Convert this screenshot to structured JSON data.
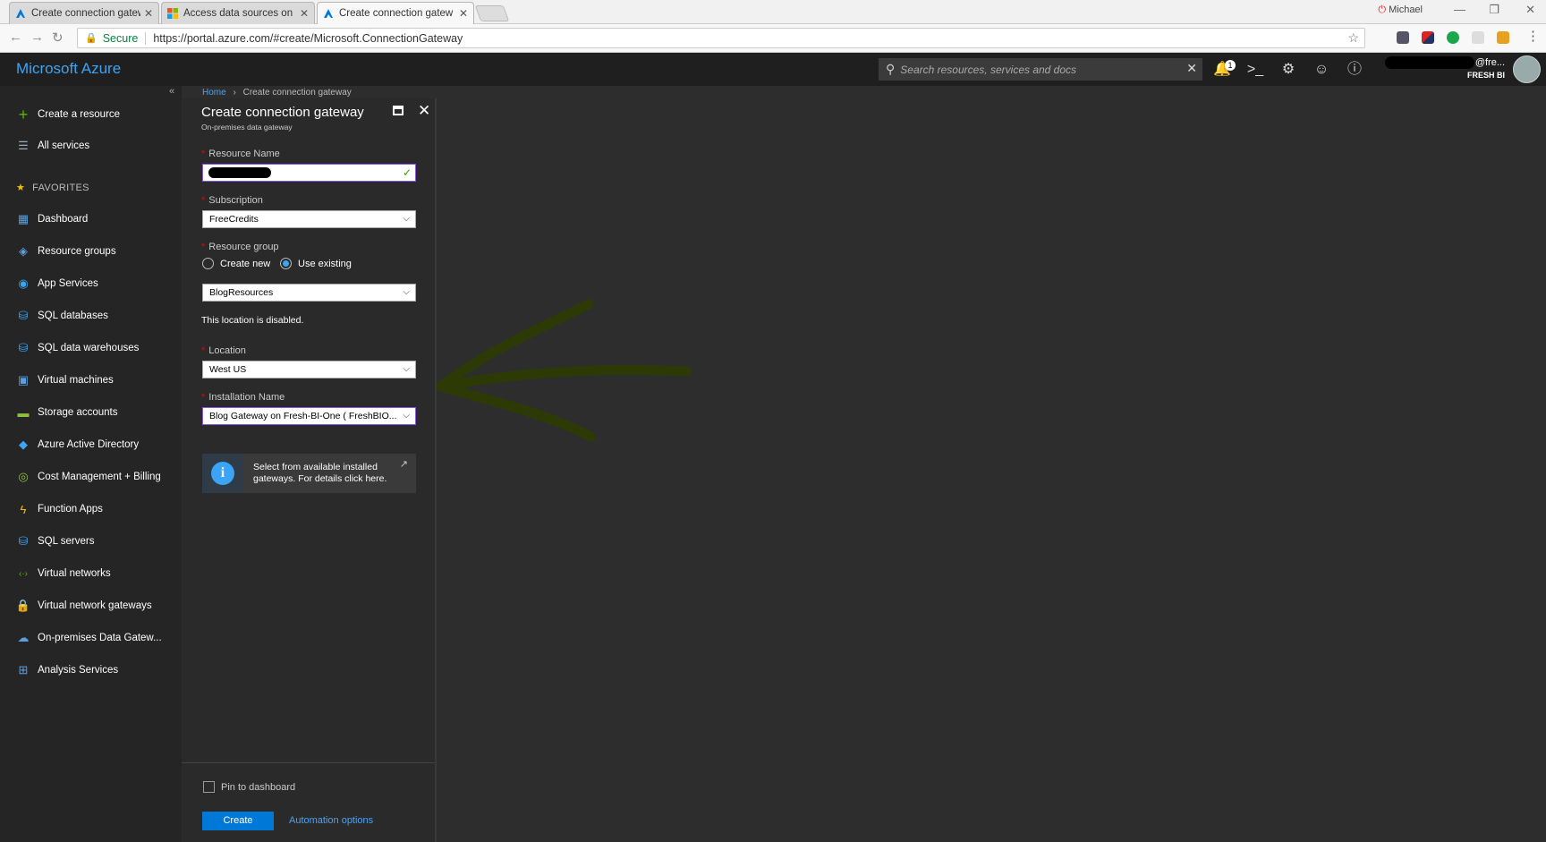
{
  "browser": {
    "tabs": [
      {
        "title": "Create connection gatew",
        "active": false
      },
      {
        "title": "Access data sources on p",
        "active": false
      },
      {
        "title": "Create connection gatew",
        "active": true
      }
    ],
    "profile_name": "Michael",
    "secure_label": "Secure",
    "url": "https://portal.azure.com/#create/Microsoft.ConnectionGateway"
  },
  "header": {
    "brand": "Microsoft Azure",
    "search_placeholder": "Search resources, services and docs",
    "notification_count": "1",
    "user_email_fragment": "@fre...",
    "user_directory": "FRESH BI"
  },
  "sidebar": {
    "top_items": [
      {
        "label": "Create a resource",
        "icon": "plus-icon"
      },
      {
        "label": "All services",
        "icon": "list-icon"
      }
    ],
    "favorites_label": "FAVORITES",
    "items": [
      {
        "label": "Dashboard",
        "icon": "dashboard-icon"
      },
      {
        "label": "Resource groups",
        "icon": "resource-groups-icon"
      },
      {
        "label": "App Services",
        "icon": "app-services-icon"
      },
      {
        "label": "SQL databases",
        "icon": "sql-database-icon"
      },
      {
        "label": "SQL data warehouses",
        "icon": "sql-warehouse-icon"
      },
      {
        "label": "Virtual machines",
        "icon": "virtual-machine-icon"
      },
      {
        "label": "Storage accounts",
        "icon": "storage-icon"
      },
      {
        "label": "Azure Active Directory",
        "icon": "active-directory-icon"
      },
      {
        "label": "Cost Management + Billing",
        "icon": "billing-icon"
      },
      {
        "label": "Function Apps",
        "icon": "function-apps-icon"
      },
      {
        "label": "SQL servers",
        "icon": "sql-server-icon"
      },
      {
        "label": "Virtual networks",
        "icon": "virtual-network-icon"
      },
      {
        "label": "Virtual network gateways",
        "icon": "network-gateway-icon"
      },
      {
        "label": "On-premises Data Gatew...",
        "icon": "data-gateway-icon"
      },
      {
        "label": "Analysis Services",
        "icon": "analysis-services-icon"
      }
    ]
  },
  "breadcrumb": {
    "home": "Home",
    "current": "Create connection gateway"
  },
  "blade": {
    "title": "Create connection gateway",
    "subtitle": "On-premises data gateway",
    "resource_name_label": "Resource Name",
    "resource_name_value": "",
    "subscription_label": "Subscription",
    "subscription_value": "FreeCredits",
    "resource_group_label": "Resource group",
    "create_new_label": "Create new",
    "use_existing_label": "Use existing",
    "resource_group_value": "BlogResources",
    "location_disabled_note": "This location is disabled.",
    "location_label": "Location",
    "location_value": "West US",
    "installation_name_label": "Installation Name",
    "installation_name_value": "Blog Gateway on Fresh-BI-One ( FreshBIO...",
    "info_text": "Select from available installed gateways. For details click here.",
    "pin_label": "Pin to dashboard",
    "create_label": "Create",
    "automation_label": "Automation options"
  },
  "colors": {
    "brand": "#3ba4f5",
    "primary_button": "#0078d7",
    "annotation_arrow": "#2e3a05"
  }
}
